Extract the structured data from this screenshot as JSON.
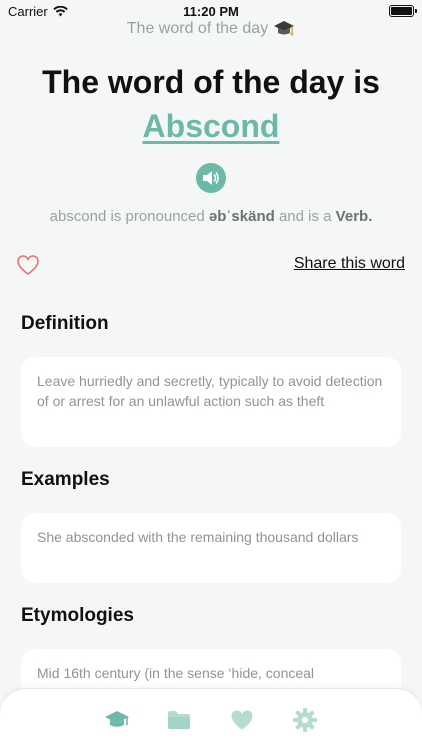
{
  "status_bar": {
    "carrier": "Carrier",
    "time": "11:20 PM"
  },
  "nav": {
    "title": "The word of the day"
  },
  "headline": "The word of the day is",
  "word": "Abscond",
  "pronunciation": {
    "prefix": "abscond is pronounced",
    "phonetic": "əbˈskänd",
    "middle": "and is a",
    "part_of_speech": "Verb."
  },
  "actions": {
    "share_label": "Share this word"
  },
  "sections": {
    "definition": {
      "title": "Definition",
      "text": "Leave hurriedly and secretly, typically to avoid detection of or arrest for an unlawful action such as theft"
    },
    "examples": {
      "title": "Examples",
      "text": "She absconded with the remaining thousand dollars"
    },
    "etymologies": {
      "title": "Etymologies",
      "text": "Mid 16th century (in the sense ‘hide, conceal"
    }
  },
  "colors": {
    "accent": "#6db9a8",
    "accent_light": "#b5dcd3",
    "heart": "#e57373",
    "background": "#f4f7f6"
  },
  "tabs": [
    {
      "icon": "graduation-cap-icon",
      "active": true
    },
    {
      "icon": "folder-icon",
      "active": false
    },
    {
      "icon": "heart-icon",
      "active": false
    },
    {
      "icon": "gear-icon",
      "active": false
    }
  ]
}
